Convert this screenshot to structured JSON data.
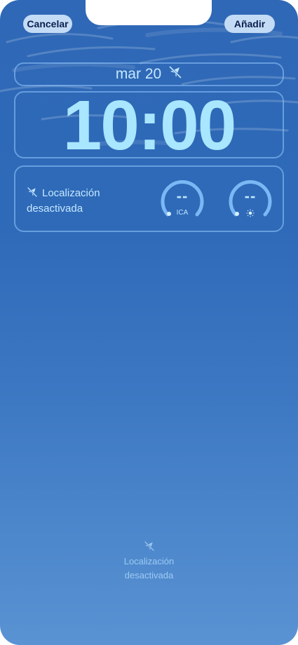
{
  "header": {
    "cancel_label": "Cancelar",
    "add_label": "Añadir"
  },
  "lockscreen": {
    "date": "mar 20",
    "time": "10:00",
    "location_widget": {
      "line1": "Localización",
      "line2": "desactivada",
      "icon": "location-off-icon"
    },
    "gauges": [
      {
        "value": "--",
        "label": "ICA"
      },
      {
        "value": "--",
        "label_icon": "sun-icon"
      }
    ],
    "bottom_notice": {
      "line1": "Localización",
      "line2": "desactivada",
      "icon": "location-off-icon"
    }
  },
  "colors": {
    "background_top": "#2f68b6",
    "background_bottom": "#5a93d3",
    "button_bg": "#c4dbf5",
    "button_text": "#0b1f4e",
    "time_text": "#a9e6ff"
  }
}
